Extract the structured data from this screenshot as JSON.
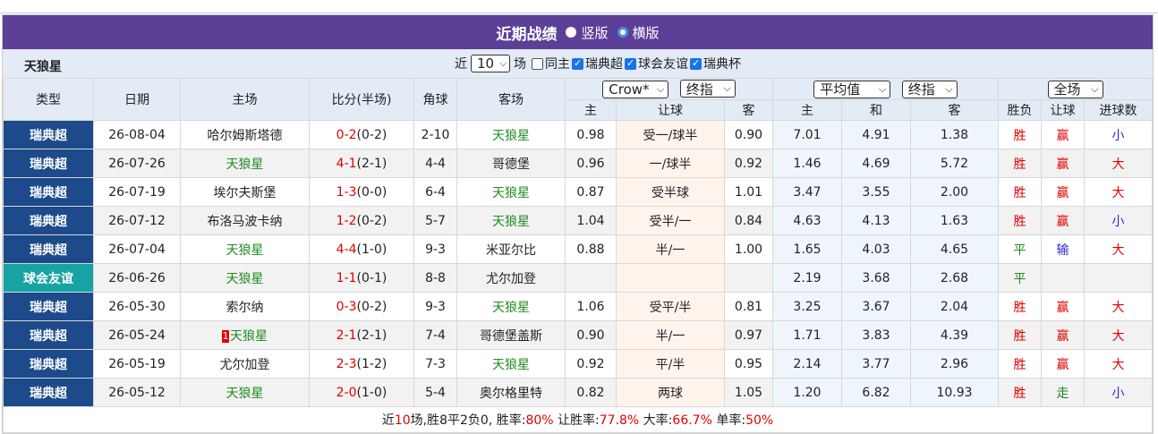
{
  "header": {
    "title": "近期战绩",
    "opt_vertical": "竖版",
    "opt_horizontal": "横版"
  },
  "filter": {
    "team": "天狼星",
    "prefix": "近",
    "count": "10",
    "suffix": "场",
    "same_home": "同主",
    "league1": "瑞典超",
    "league2": "球会友谊",
    "league3": "瑞典杯"
  },
  "columns": {
    "type": "类型",
    "date": "日期",
    "home": "主场",
    "score": "比分(半场)",
    "corner": "角球",
    "away": "客场",
    "company": "Crow*",
    "odds_mode": "终指",
    "avg": "平均值",
    "avg_mode": "终指",
    "scope": "全场",
    "ah_home": "主",
    "ah_line": "让球",
    "ah_away": "客",
    "eu_home": "主",
    "eu_draw": "和",
    "eu_away": "客",
    "wl": "胜负",
    "handicap": "让球",
    "goals": "进球数"
  },
  "rows": [
    {
      "lg": "瑞典超",
      "date": "26-08-04",
      "home": "哈尔姆斯塔德",
      "ft": "0-2",
      "ht": "(0-2)",
      "corner": "2-10",
      "away": "天狼星",
      "o1": "0.98",
      "line": "受一/球半",
      "o2": "0.90",
      "e1": "7.01",
      "e2": "4.91",
      "e3": "1.38",
      "wl": "胜",
      "ah": "赢",
      "ou": "小"
    },
    {
      "lg": "瑞典超",
      "date": "26-07-26",
      "home": "天狼星",
      "ft": "4-1",
      "ht": "(2-1)",
      "corner": "4-4",
      "away": "哥德堡",
      "o1": "0.96",
      "line": "一/球半",
      "o2": "0.92",
      "e1": "1.46",
      "e2": "4.69",
      "e3": "5.72",
      "wl": "胜",
      "ah": "赢",
      "ou": "大"
    },
    {
      "lg": "瑞典超",
      "date": "26-07-19",
      "home": "埃尔夫斯堡",
      "ft": "1-3",
      "ht": "(0-0)",
      "corner": "6-4",
      "away": "天狼星",
      "o1": "0.87",
      "line": "受半球",
      "o2": "1.01",
      "e1": "3.47",
      "e2": "3.55",
      "e3": "2.00",
      "wl": "胜",
      "ah": "赢",
      "ou": "大"
    },
    {
      "lg": "瑞典超",
      "date": "26-07-12",
      "home": "布洛马波卡纳",
      "ft": "1-2",
      "ht": "(0-2)",
      "corner": "5-7",
      "away": "天狼星",
      "o1": "1.04",
      "line": "受半/一",
      "o2": "0.84",
      "e1": "4.63",
      "e2": "4.13",
      "e3": "1.63",
      "wl": "胜",
      "ah": "赢",
      "ou": "小"
    },
    {
      "lg": "瑞典超",
      "date": "26-07-04",
      "home": "天狼星",
      "ft": "4-4",
      "ht": "(1-0)",
      "corner": "9-3",
      "away": "米亚尔比",
      "o1": "0.88",
      "line": "半/一",
      "o2": "1.00",
      "e1": "1.65",
      "e2": "4.03",
      "e3": "4.65",
      "wl": "平",
      "ah": "输",
      "ou": "大"
    },
    {
      "lg": "球会友谊",
      "date": "26-06-26",
      "home": "天狼星",
      "ft": "1-1",
      "ht": "(0-1)",
      "corner": "8-8",
      "away": "尤尔加登",
      "o1": "",
      "line": "",
      "o2": "",
      "e1": "2.19",
      "e2": "3.68",
      "e3": "2.68",
      "wl": "平",
      "ah": "",
      "ou": ""
    },
    {
      "lg": "瑞典超",
      "date": "26-05-30",
      "home": "索尔纳",
      "ft": "0-3",
      "ht": "(0-2)",
      "corner": "9-3",
      "away": "天狼星",
      "o1": "1.06",
      "line": "受平/半",
      "o2": "0.81",
      "e1": "3.25",
      "e2": "3.67",
      "e3": "2.04",
      "wl": "胜",
      "ah": "赢",
      "ou": "大"
    },
    {
      "lg": "瑞典超",
      "date": "26-05-24",
      "home": "天狼星",
      "redcard": "1",
      "ft": "2-1",
      "ht": "(2-1)",
      "corner": "7-4",
      "away": "哥德堡盖斯",
      "o1": "0.90",
      "line": "半/一",
      "o2": "0.97",
      "e1": "1.71",
      "e2": "3.83",
      "e3": "4.39",
      "wl": "胜",
      "ah": "赢",
      "ou": "大"
    },
    {
      "lg": "瑞典超",
      "date": "26-05-19",
      "home": "尤尔加登",
      "ft": "2-3",
      "ht": "(1-2)",
      "corner": "7-3",
      "away": "天狼星",
      "o1": "0.92",
      "line": "平/半",
      "o2": "0.95",
      "e1": "2.14",
      "e2": "3.77",
      "e3": "2.96",
      "wl": "胜",
      "ah": "赢",
      "ou": "大"
    },
    {
      "lg": "瑞典超",
      "date": "26-05-12",
      "home": "天狼星",
      "ft": "2-0",
      "ht": "(1-0)",
      "corner": "5-4",
      "away": "奥尔格里特",
      "o1": "0.82",
      "line": "两球",
      "o2": "1.05",
      "e1": "1.20",
      "e2": "6.82",
      "e3": "10.93",
      "wl": "胜",
      "ah": "走",
      "ou": "小"
    }
  ],
  "summary": {
    "t1": "近",
    "n": "10",
    "t2": "场,胜8平2负0, 胜率:",
    "win_rate": "80%",
    "t3": " 让胜率:",
    "ah_rate": "77.8%",
    "t4": " 大率:",
    "over_rate": "66.7%",
    "t5": " 单率:",
    "odd_rate": "50%"
  },
  "colors": {
    "header_bg": "#5c3f97",
    "league_bg": "#1d4a8a",
    "friendly_bg": "#17a3a3",
    "win": "#e00000",
    "team": "#1f8a1f",
    "small": "#2a2ad8"
  }
}
